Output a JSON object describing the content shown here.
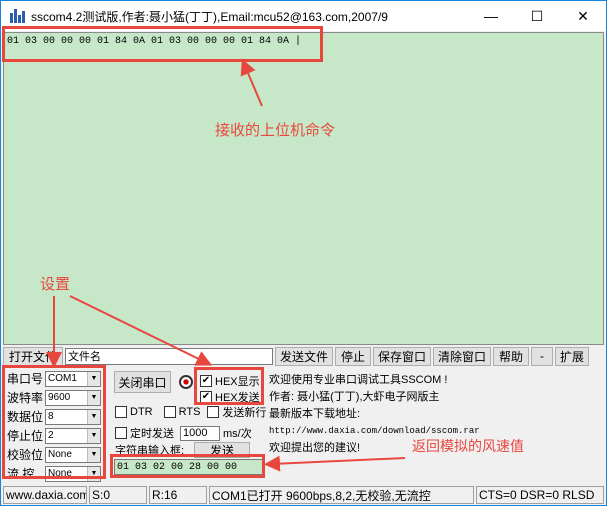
{
  "titlebar": {
    "title": "sscom4.2测试版,作者:聂小猛(丁丁),Email:mcu52@163.com,2007/9",
    "minimize": "—",
    "maximize": "☐",
    "close": "✕"
  },
  "receive": {
    "text": "01 03 00 00 00 01 84 0A 01 03 00 00 00 01 84 0A |"
  },
  "toolbar": {
    "open_file": "打开文件",
    "filename": "文件名",
    "send_file": "发送文件",
    "stop": "停止",
    "save_window": "保存窗口",
    "clear_window": "清除窗口",
    "help": "帮助",
    "minus": "-",
    "expand": "扩展"
  },
  "settings": {
    "port_label": "串口号",
    "port_value": "COM1",
    "baud_label": "波特率",
    "baud_value": "9600",
    "databits_label": "数据位",
    "databits_value": "8",
    "stopbits_label": "停止位",
    "stopbits_value": "2",
    "parity_label": "校验位",
    "parity_value": "None",
    "flow_label": "流 控",
    "flow_value": "None"
  },
  "controls": {
    "close_port": "关闭串口",
    "hex_display": "HEX显示",
    "hex_send": "HEX发送",
    "dtr": "DTR",
    "rts": "RTS",
    "send_newline": "发送新行",
    "timed_send": "定时发送",
    "interval_value": "1000",
    "interval_unit": "ms/次",
    "input_label": "字符串输入框:",
    "send": "发送",
    "send_text": "01 03 02 00 28 00 00"
  },
  "info": {
    "line1": "欢迎使用专业串口调试工具SSCOM !",
    "line2": "作者: 聂小猛(丁丁),大虾电子网版主",
    "line3": "最新版本下载地址:",
    "line4": "http://www.daxia.com/download/sscom.rar",
    "line5": "欢迎提出您的建议!"
  },
  "annotations": {
    "recv_note": "接收的上位机命令",
    "settings_note": "设置",
    "reply_note": "返回模拟的风速值"
  },
  "status": {
    "url": "www.daxia.com",
    "sent": "S:0",
    "received": "R:16",
    "port_status": "COM1已打开  9600bps,8,2,无校验,无流控",
    "lines": "CTS=0 DSR=0 RLSD"
  },
  "colors": {
    "annotation": "#e8473e",
    "receive_bg": "#c7e8c8"
  }
}
